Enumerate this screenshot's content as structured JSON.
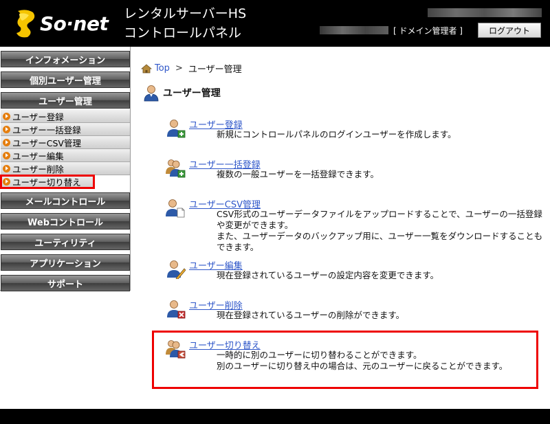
{
  "header": {
    "logo_text": "So·net",
    "product_line1": "レンタルサーバーHS",
    "product_line2": "コントロールパネル",
    "role": "[ ドメイン管理者 ]",
    "logout_label": "ログアウト"
  },
  "sidebar": {
    "categories": [
      "インフォメーション",
      "個別ユーザー管理",
      "ユーザー管理",
      "メールコントロール",
      "Webコントロール",
      "ユーティリティ",
      "アプリケーション",
      "サポート"
    ],
    "sub_items": [
      "ユーザー登録",
      "ユーザー一括登録",
      "ユーザーCSV管理",
      "ユーザー編集",
      "ユーザー削除",
      "ユーザー切り替え"
    ]
  },
  "breadcrumb": {
    "top": "Top",
    "separator": ">",
    "current": "ユーザー管理"
  },
  "page_title": "ユーザー管理",
  "items": [
    {
      "link": "ユーザー登録",
      "desc": "新規にコントロールパネルのログインユーザーを作成します。"
    },
    {
      "link": "ユーザー一括登録",
      "desc": "複数の一般ユーザーを一括登録できます。"
    },
    {
      "link": "ユーザーCSV管理",
      "desc": "CSV形式のユーザーデータファイルをアップロードすることで、ユーザーの一括登録や変更ができます。",
      "desc2": "また、ユーザーデータのバックアップ用に、ユーザー一覧をダウンロードすることもできます。"
    },
    {
      "link": "ユーザー編集",
      "desc": "現在登録されているユーザーの設定内容を変更できます。"
    },
    {
      "link": "ユーザー削除",
      "desc": "現在登録されているユーザーの削除ができます。"
    },
    {
      "link": "ユーザー切り替え",
      "desc": "一時的に別のユーザーに切り替わることができます。",
      "desc2": "別のユーザーに切り替え中の場合は、元のユーザーに戻ることができます。"
    }
  ]
}
